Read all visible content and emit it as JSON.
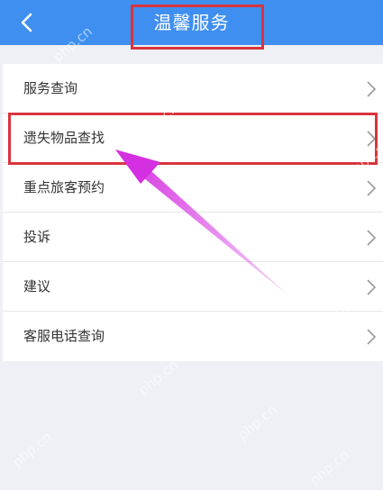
{
  "header": {
    "title": "温馨服务",
    "back_icon": "chevron-left-icon"
  },
  "menu": {
    "items": [
      {
        "label": "服务查询"
      },
      {
        "label": "遗失物品查找"
      },
      {
        "label": "重点旅客预约"
      },
      {
        "label": "投诉"
      },
      {
        "label": "建议"
      },
      {
        "label": "客服电话查询"
      }
    ]
  },
  "annotations": {
    "highlight_color": "#d9343c",
    "arrow_color": "#d42fe0"
  },
  "watermark": {
    "text": "php.cn"
  },
  "colors": {
    "header_bg": "#3f8ff0",
    "page_bg": "#eff0f5"
  }
}
